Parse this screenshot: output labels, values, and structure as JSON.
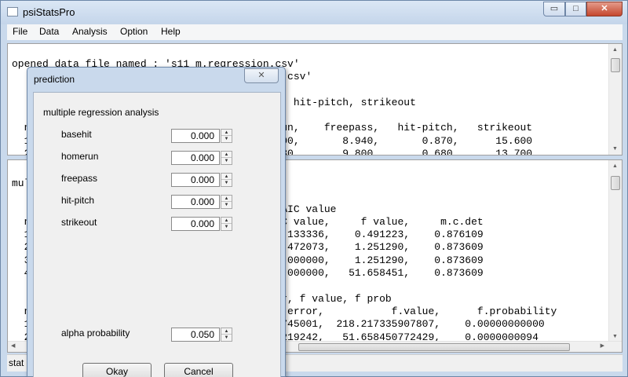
{
  "window": {
    "title": "psiStatsPro",
    "minimize_glyph": "▭",
    "maximize_glyph": "□",
    "close_glyph": "✕"
  },
  "menu": [
    "File",
    "Data",
    "Analysis",
    "Option",
    "Help"
  ],
  "top_pane": {
    "lines": [
      "opened data file named : 's11 m.regression.csv'",
      "                                     ression.csv'",
      "",
      "                                     reepass, hit-pitch, strikeout",
      "",
      "  n                                    homerun,    freepass,   hit-pitch,   strikeout",
      "  1                                      3.100,       8.940,       0.870,      15.600",
      "  2                                      2.530,       9.800,       0.680,      13.700"
    ]
  },
  "bottom_pane": {
    "lines": [
      "mul",
      "",
      "                                     due to AIC value",
      "  n                                  t,   AIC value,     f value,     m.c.det",
      "  1                                  t,    2.133336,    0.491223,    0.876109",
      "  2                                  t,    1.472073,    1.251290,    0.873609",
      "  3                                  e,    0.000000,    1.251290,    0.873609",
      "  4                                  e,    0.000000,   51.658451,    0.873609",
      "",
      "                                     rd error, f value, f prob",
      "  n                                        s.error,           f.value,      f.probability",
      "  1                                  .016802745001,  218.217335907807,    0.00000000000",
      "  2                                  .054184219242,   51.658450772429,    0.0000000094"
    ]
  },
  "status": {
    "text": "stat"
  },
  "dialog": {
    "title": "prediction",
    "close_glyph": "✕",
    "section": "multiple regression analysis",
    "fields": [
      {
        "label": "basehit",
        "value": "0.000"
      },
      {
        "label": "homerun",
        "value": "0.000"
      },
      {
        "label": "freepass",
        "value": "0.000"
      },
      {
        "label": "hit-pitch",
        "value": "0.000"
      },
      {
        "label": "strikeout",
        "value": "0.000"
      }
    ],
    "alpha": {
      "label": "alpha probability",
      "value": "0.050"
    },
    "okay_label": "Okay",
    "cancel_label": "Cancel"
  }
}
